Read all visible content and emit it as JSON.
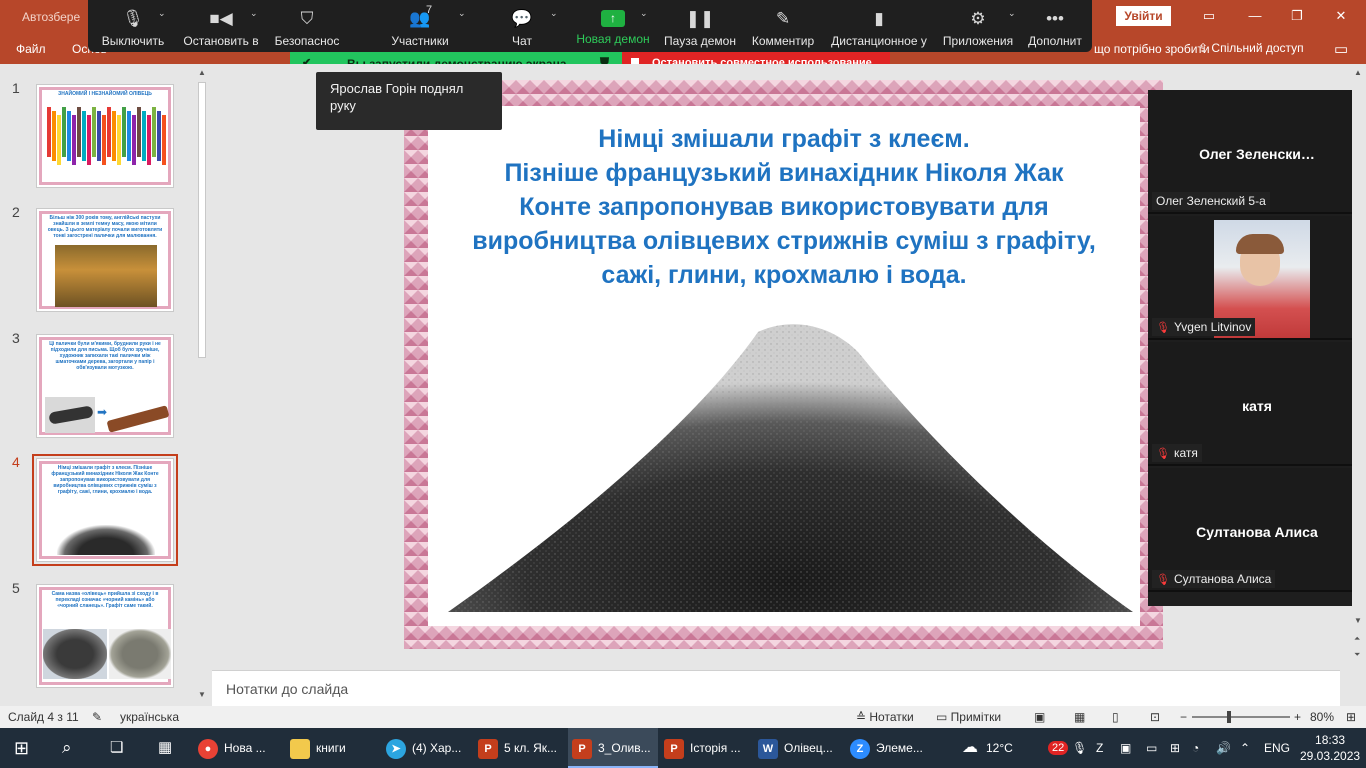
{
  "ppt": {
    "autosave": "Автозбере",
    "signin": "Увійти",
    "menu": [
      "Файл",
      "Основ"
    ],
    "right_text": "що потрібно зробити",
    "share": "Спільний доступ"
  },
  "zoom": {
    "buttons": {
      "mute": "Выключить",
      "stop_video": "Остановить в",
      "security": "Безопаснос",
      "participants": "Участники",
      "participants_count": "7",
      "chat": "Чат",
      "new_share": "Новая демон",
      "pause_share": "Пауза демон",
      "annotate": "Комментир",
      "remote": "Дистанционное у",
      "apps": "Приложения",
      "more": "Дополнит"
    },
    "share_banner": "Вы запустили демонстрацию экрана",
    "stop_share": "Остановить совместное использование",
    "raise_hand_toast": "Ярослав Горін поднял руку"
  },
  "thumbnails": [
    {
      "num": "1",
      "text": "ЗНАЙОМИЙ І НЕЗНАЙОМИЙ ОЛІВЕЦЬ"
    },
    {
      "num": "2",
      "text": "Більш ніж 300 років тому, англійські пастухи знайшли в землі темну масу, якою мітили овець. З цього матеріалу почали виготовляти тонкі загострені палички для малювання."
    },
    {
      "num": "3",
      "text": "Ці палички були м'якими, бруднили руки і не підходили для письма. Щоб було зручніше, художник запихали такі палички між шматочками дерева, загортали у папір і обв'язували мотузкою."
    },
    {
      "num": "4",
      "text": "Німці змішали графіт з клеєм. Пізніше французький винахідник Ніколя Жак Конте запропонував використовувати для виробництва олівцевих стрижнів суміш з графіту, сажі, глини, крохмалю і вода."
    },
    {
      "num": "5",
      "text": "Сама назва «олівець» прийшла зі сходу і в перекладі означає «чорний камінь» або «чорний сланець». Графіт саме такий."
    }
  ],
  "slide": {
    "lines": [
      "Німці змішали графіт з клеєм.",
      "Пізніше французький винахідник Ніколя Жак",
      "Конте запропонував використовувати для",
      "виробництва олівцевих стрижнів суміш з графіту,",
      "сажі, глини, крохмалю і вода."
    ]
  },
  "notes_placeholder": "Нотатки до слайда",
  "gallery": [
    {
      "big": "Олег  Зеленски…",
      "tag": "Олег Зеленский 5-а",
      "muted": false,
      "video": false
    },
    {
      "big": "",
      "tag": "Yvgen Litvinov",
      "muted": true,
      "video": true
    },
    {
      "big": "катя",
      "tag": "катя",
      "muted": true,
      "video": false
    },
    {
      "big": "Султанова Алиса",
      "tag": "Султанова Алиса",
      "muted": true,
      "video": false
    }
  ],
  "status": {
    "slide": "Слайд 4 з 11",
    "lang": "українська",
    "notes": "Нотатки",
    "comments": "Примітки",
    "zoom": "80%"
  },
  "taskbar": {
    "apps": [
      {
        "label": "Нова ...",
        "color": "#e94235"
      },
      {
        "label": "книги",
        "color": "#f2c94c"
      },
      {
        "label": "(4) Хар...",
        "color": "#2ca5e0"
      },
      {
        "label": "5 кл. Як...",
        "color": "#c43e1c"
      },
      {
        "label": "3_Олив...",
        "color": "#c43e1c"
      },
      {
        "label": "Історія ...",
        "color": "#c43e1c"
      },
      {
        "label": "Олівец...",
        "color": "#2b579a"
      },
      {
        "label": "Элеме...",
        "color": "#2d8cff"
      }
    ],
    "weather": "12°C",
    "lang": "ENG",
    "time": "18:33",
    "date": "29.03.2023",
    "badge": "22"
  }
}
